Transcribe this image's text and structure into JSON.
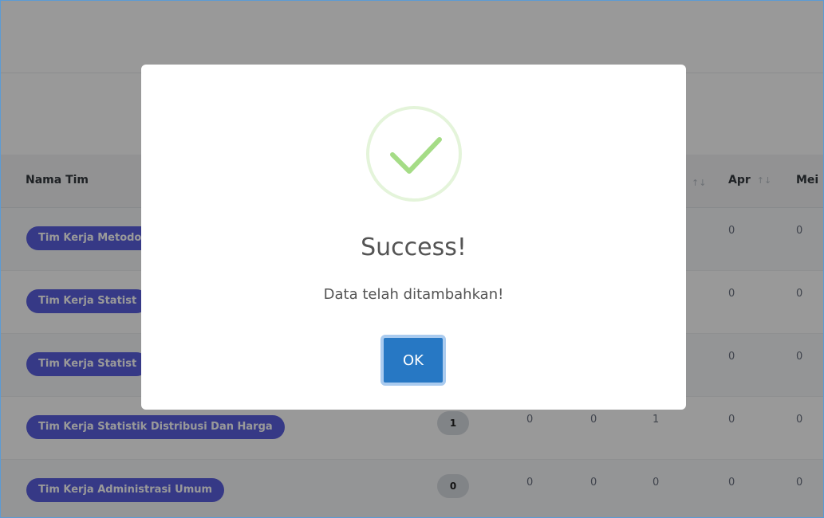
{
  "table": {
    "headers": {
      "nama_tim": "Nama Tim",
      "apr": "Apr",
      "mei": "Mei"
    },
    "rows": [
      {
        "name": "Tim Kerja Metodo",
        "badge": "",
        "jan": "",
        "feb": "",
        "mar": "",
        "apr": "0",
        "mei": "0"
      },
      {
        "name": "Tim Kerja Statist",
        "badge": "",
        "jan": "",
        "feb": "",
        "mar": "",
        "apr": "0",
        "mei": "0"
      },
      {
        "name": "Tim Kerja Statist",
        "badge": "",
        "jan": "",
        "feb": "",
        "mar": "",
        "apr": "0",
        "mei": "0"
      },
      {
        "name": "Tim Kerja Statistik Distribusi Dan Harga",
        "badge": "1",
        "jan": "0",
        "feb": "0",
        "mar": "1",
        "apr": "0",
        "mei": "0"
      },
      {
        "name": "Tim Kerja Administrasi Umum",
        "badge": "0",
        "jan": "0",
        "feb": "0",
        "mar": "0",
        "apr": "0",
        "mei": "0"
      }
    ]
  },
  "modal": {
    "title": "Success!",
    "message": "Data telah ditambahkan!",
    "ok_label": "OK",
    "icon": "check-icon"
  },
  "colors": {
    "pill": "#5a5fe0",
    "ok_button": "#2778c4",
    "check": "#a5dc86"
  }
}
